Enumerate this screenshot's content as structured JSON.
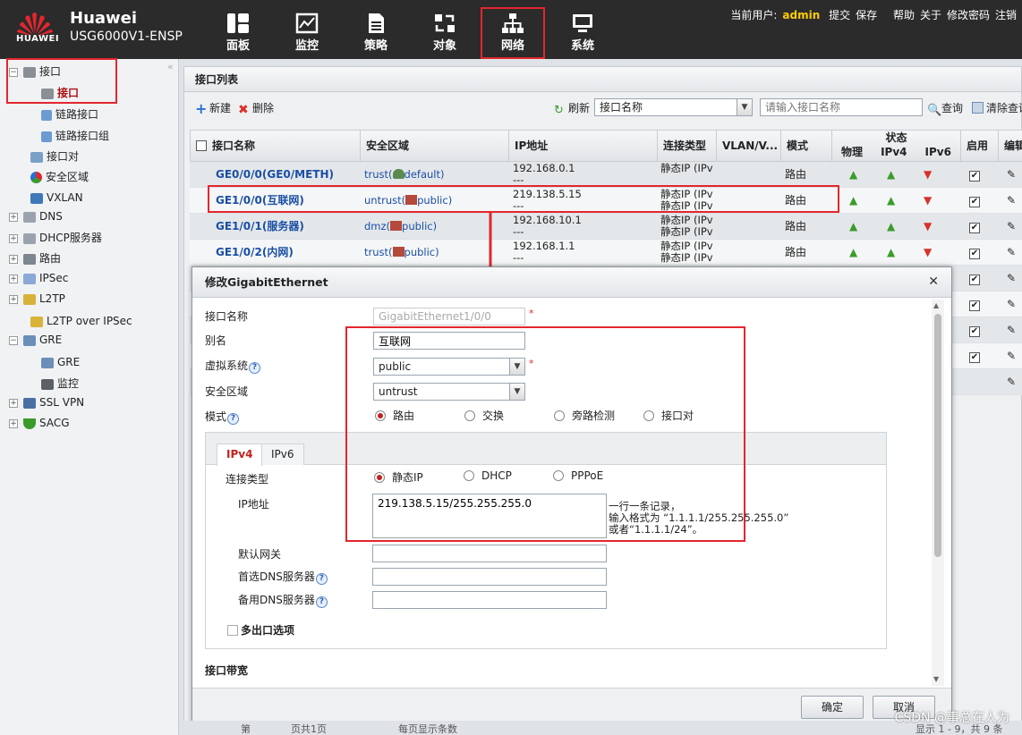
{
  "brand": {
    "logo_text": "HUAWEI",
    "name": "Huawei",
    "model": "USG6000V1-ENSP"
  },
  "nav": [
    {
      "label": "面板",
      "icon": "dashboard-icon"
    },
    {
      "label": "监控",
      "icon": "monitor-icon"
    },
    {
      "label": "策略",
      "icon": "policy-icon"
    },
    {
      "label": "对象",
      "icon": "object-icon"
    },
    {
      "label": "网络",
      "icon": "network-icon",
      "active": true
    },
    {
      "label": "系统",
      "icon": "system-icon"
    }
  ],
  "userbar": {
    "current_user_label": "当前用户:",
    "username": "admin",
    "commit": "提交",
    "save": "保存",
    "help": "帮助",
    "about": "关于",
    "change_password": "修改密码",
    "logout": "注销"
  },
  "sidebar": {
    "items": [
      {
        "label": "接口"
      },
      {
        "label": "接口"
      },
      {
        "label": "链路接口"
      },
      {
        "label": "链路接口组"
      },
      {
        "label": "接口对"
      },
      {
        "label": "安全区域"
      },
      {
        "label": "VXLAN"
      },
      {
        "label": "DNS"
      },
      {
        "label": "DHCP服务器"
      },
      {
        "label": "路由"
      },
      {
        "label": "IPSec"
      },
      {
        "label": "L2TP"
      },
      {
        "label": "L2TP over IPSec"
      },
      {
        "label": "GRE"
      },
      {
        "label": "GRE"
      },
      {
        "label": "监控"
      },
      {
        "label": "SSL VPN"
      },
      {
        "label": "SACG"
      }
    ]
  },
  "main": {
    "title": "接口列表",
    "toolbar": {
      "new": "新建",
      "delete": "删除",
      "refresh": "刷新",
      "filter_select": "接口名称",
      "search_placeholder": "请输入接口名称",
      "query": "查询",
      "clear_query": "清除查询"
    },
    "columns": {
      "name": "接口名称",
      "zone": "安全区域",
      "ip": "IP地址",
      "conn_type": "连接类型",
      "vlan": "VLAN/V...",
      "mode": "模式",
      "status": "状态",
      "physical": "物理",
      "ipv4": "IPv4",
      "ipv6": "IPv6",
      "enable": "启用",
      "edit": "编辑"
    },
    "rows": [
      {
        "name": "GE0/0/0(GE0/METH)",
        "zone_prefix": "trust(",
        "zone_vsys": "default)",
        "ip_line1": "192.168.0.1",
        "ip_line2": "---",
        "conn_line1": "静态IP (IPv",
        "conn_line2": "",
        "mode": "路由"
      },
      {
        "name": "GE1/0/0(互联网)",
        "zone_prefix": "untrust(",
        "zone_vsys": "public)",
        "ip_line1": "219.138.5.15",
        "ip_line2": "---",
        "conn_line1": "静态IP (IPv",
        "conn_line2": "静态IP (IPv",
        "mode": "路由"
      },
      {
        "name": "GE1/0/1(服务器)",
        "zone_prefix": "dmz(",
        "zone_vsys": "public)",
        "ip_line1": "192.168.10.1",
        "ip_line2": "---",
        "conn_line1": "静态IP (IPv",
        "conn_line2": "静态IP (IPv",
        "mode": "路由"
      },
      {
        "name": "GE1/0/2(内网)",
        "zone_prefix": "trust(",
        "zone_vsys": "public)",
        "ip_line1": "192.168.1.1",
        "ip_line2": "---",
        "conn_line1": "静态IP (IPv",
        "conn_line2": "静态IP (IPv",
        "mode": "路由"
      }
    ]
  },
  "dialog": {
    "title": "修改GigabitEthernet",
    "iface_name_label": "接口名称",
    "iface_name_value": "GigabitEthernet1/0/0",
    "alias_label": "别名",
    "alias_value": "互联网",
    "vsys_label": "虚拟系统",
    "vsys_value": "public",
    "zone_label": "安全区域",
    "zone_value": "untrust",
    "mode_label": "模式",
    "mode_options": [
      "路由",
      "交换",
      "旁路检测",
      "接口对"
    ],
    "tabs": [
      "IPv4",
      "IPv6"
    ],
    "conn_type_label": "连接类型",
    "conn_type_options": [
      "静态IP",
      "DHCP",
      "PPPoE"
    ],
    "ip_label": "IP地址",
    "ip_value": "219.138.5.15/255.255.255.0",
    "ip_hint_1": "一行一条记录，",
    "ip_hint_2": "输入格式为 “1.1.1.1/255.255.255.0”",
    "ip_hint_3": "或者“1.1.1.1/24”。",
    "gateway_label": "默认网关",
    "dns1_label": "首选DNS服务器",
    "dns2_label": "备用DNS服务器",
    "multi_exit_label": "多出口选项",
    "bandwidth_label": "接口带宽",
    "ok": "确定",
    "cancel": "取消"
  },
  "watermark": "CSDN @事总在人为",
  "pager": {
    "page_label": "第",
    "page_total": "页共1页",
    "per_page": "每页显示条数",
    "summary": "显示 1 - 9，共 9 条"
  },
  "colors": {
    "accent_red": "#e3262d",
    "topbar": "#2b2b2b",
    "link_blue": "#1a4fa3",
    "status_up": "#3a9b2b",
    "status_down": "#d8322b"
  }
}
